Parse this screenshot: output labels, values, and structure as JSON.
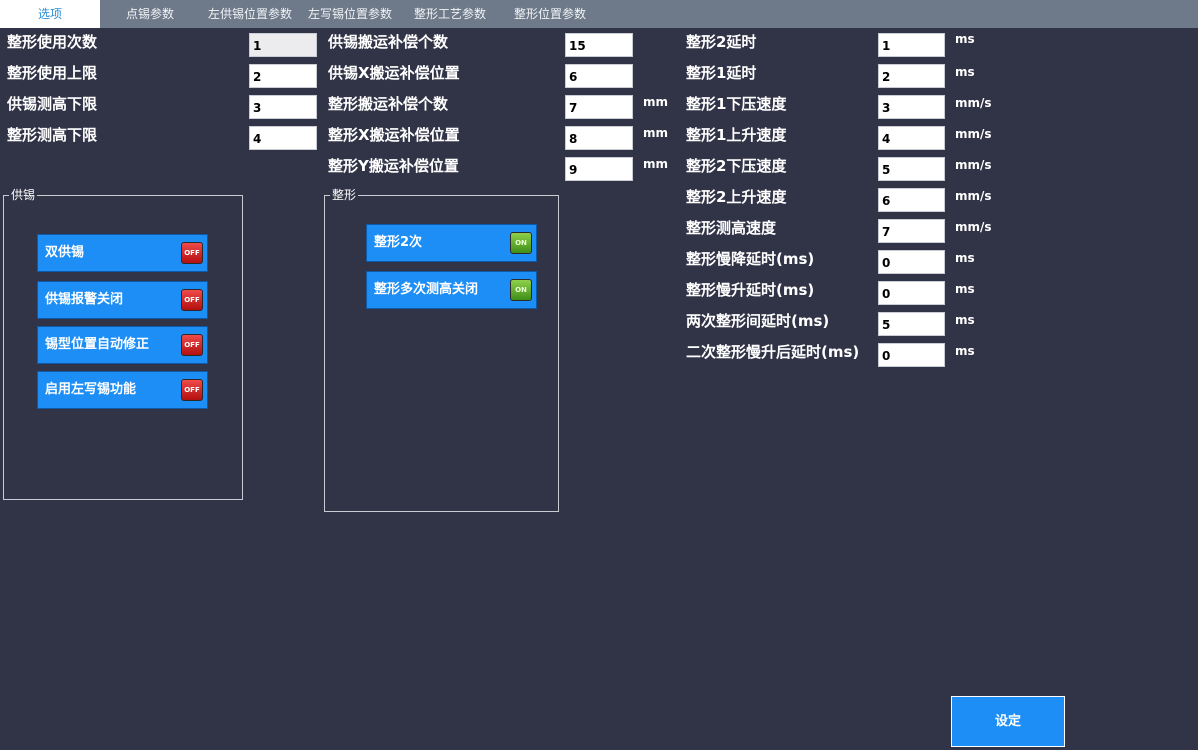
{
  "tabs": [
    "选项",
    "点锡参数",
    "左供锡位置参数",
    "左写锡位置参数",
    "整形工艺参数",
    "整形位置参数"
  ],
  "col1": [
    {
      "label": "整形使用次数",
      "value": "1"
    },
    {
      "label": "整形使用上限",
      "value": "2"
    },
    {
      "label": "供锡测高下限",
      "value": "3"
    },
    {
      "label": "整形测高下限",
      "value": "4"
    }
  ],
  "col2": [
    {
      "label": "供锡搬运补偿个数",
      "value": "15",
      "unit": ""
    },
    {
      "label": "供锡X搬运补偿位置",
      "value": "6",
      "unit": ""
    },
    {
      "label": "整形搬运补偿个数",
      "value": "7",
      "unit": "mm"
    },
    {
      "label": "整形X搬运补偿位置",
      "value": "8",
      "unit": "mm"
    },
    {
      "label": "整形Y搬运补偿位置",
      "value": "9",
      "unit": "mm"
    }
  ],
  "col3": [
    {
      "label": "整形2延时",
      "value": "1",
      "unit": "ms"
    },
    {
      "label": "整形1延时",
      "value": "2",
      "unit": "ms"
    },
    {
      "label": "整形1下压速度",
      "value": "3",
      "unit": "mm/s"
    },
    {
      "label": "整形1上升速度",
      "value": "4",
      "unit": "mm/s"
    },
    {
      "label": "整形2下压速度",
      "value": "5",
      "unit": "mm/s"
    },
    {
      "label": "整形2上升速度",
      "value": "6",
      "unit": "mm/s"
    },
    {
      "label": "整形测高速度",
      "value": "7",
      "unit": "mm/s"
    },
    {
      "label": "整形慢降延时(ms)",
      "value": "0",
      "unit": "ms"
    },
    {
      "label": "整形慢升延时(ms)",
      "value": "0",
      "unit": "ms"
    },
    {
      "label": "两次整形间延时(ms)",
      "value": "5",
      "unit": "ms"
    },
    {
      "label": "二次整形慢升后延时(ms)",
      "value": "0",
      "unit": "ms"
    }
  ],
  "supply_group": {
    "title": "供锡",
    "buttons": [
      {
        "label": "双供锡",
        "state": "OFF"
      },
      {
        "label": "供锡报警关闭",
        "state": "OFF"
      },
      {
        "label": "锡型位置自动修正",
        "state": "OFF"
      },
      {
        "label": "启用左写锡功能",
        "state": "OFF"
      }
    ]
  },
  "shape_group": {
    "title": "整形",
    "buttons": [
      {
        "label": "整形2次",
        "state": "ON"
      },
      {
        "label": "整形多次测高关闭",
        "state": "ON"
      }
    ]
  },
  "set_button": "设定",
  "colors": {
    "background": "#313347",
    "tabbar": "#6e7a8a",
    "button": "#1c8ef5",
    "off": "#d42020",
    "on": "#5aa82a"
  }
}
